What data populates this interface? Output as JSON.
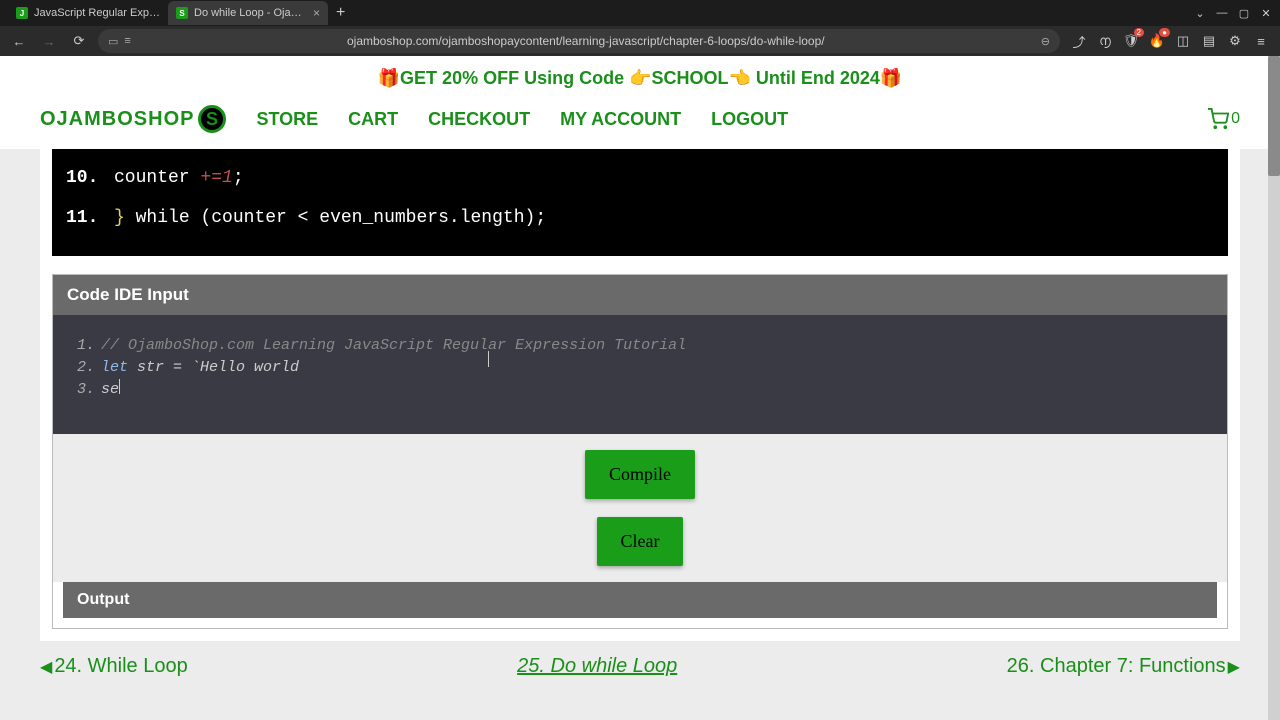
{
  "browser": {
    "tabs": [
      {
        "title": "JavaScript Regular Expression ",
        "favicon": "J"
      },
      {
        "title": "Do while Loop - OjamboSha",
        "favicon": "S"
      }
    ],
    "url": "ojamboshop.com/ojamboshopaycontent/learning-javascript/chapter-6-loops/do-while-loop/",
    "ext_badge": "2"
  },
  "promo": "🎁GET 20% OFF Using Code 👉SCHOOL👈 Until End 2024🎁",
  "nav": {
    "brand": "OJAMBOSHOP",
    "links": [
      "STORE",
      "CART",
      "CHECKOUT",
      "MY ACCOUNT",
      "LOGOUT"
    ],
    "cart_count": "0"
  },
  "code_top": {
    "l10_num": "10.",
    "l10_indent": "   counter ",
    "l10_op": "+=",
    "l10_val": "1",
    "l10_end": ";",
    "l11_num": "11.",
    "l11_brace": "}",
    "l11_while": " while ",
    "l11_open": "(",
    "l11_expr": "counter < even_numbers.length",
    "l11_close": ")",
    "l11_end": ";"
  },
  "ide": {
    "header": "Code IDE Input",
    "l1": "// OjamboShop.com Learning JavaScript Regular Expression Tutorial",
    "l2_kw": "let",
    "l2_rest": " str = `Hello world",
    "l3": "se",
    "compile": "Compile",
    "clear": "Clear",
    "output_header": "Output"
  },
  "bottom": {
    "prev": "24. While Loop",
    "current": "25. Do while Loop",
    "next": "26. Chapter 7: Functions"
  }
}
